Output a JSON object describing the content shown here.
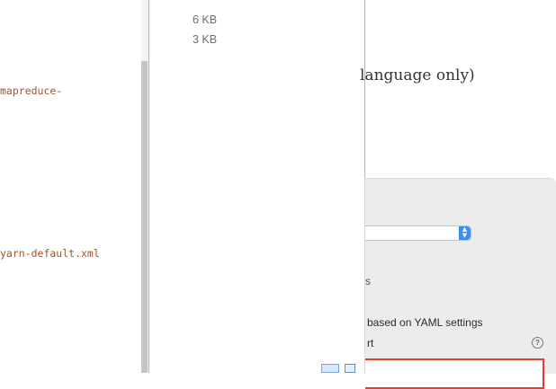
{
  "code": {
    "lines": [
      "mapreduce-",
      "yarn-default.xml"
    ]
  },
  "files": {
    "sizes": [
      "6 KB",
      "3 KB"
    ]
  },
  "document": {
    "text_fragment": "language only)"
  },
  "dialog": {
    "fragment": "s",
    "option_text": "based on YAML settings",
    "label_fragment": "rt",
    "help_glyph": "?",
    "select_arrow": "⌃⌄"
  },
  "view_buttons": [
    "icon-view-icon",
    "list-view-icon"
  ],
  "colors": {
    "code_text": "#a0522d",
    "select_accent": "#3d8cf2",
    "highlight_border": "#e53d2b"
  }
}
